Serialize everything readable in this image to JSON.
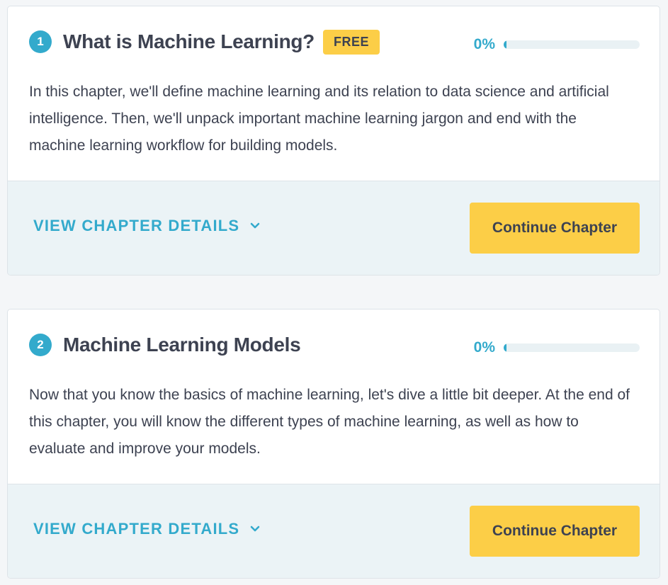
{
  "chapters": [
    {
      "number": "1",
      "title": "What is Machine Learning?",
      "badge": "FREE",
      "progress_text": "0%",
      "progress": 0,
      "description": "In this chapter, we'll define machine learning and its relation to data science and artificial intelligence. Then, we'll unpack important machine learning jargon and end with the machine learning workflow for building models.",
      "details_label": "VIEW CHAPTER DETAILS",
      "button_label": "Continue Chapter"
    },
    {
      "number": "2",
      "title": "Machine Learning Models",
      "progress_text": "0%",
      "progress": 0,
      "description": "Now that you know the basics of machine learning, let's dive a little bit deeper. At the end of this chapter, you will know the different types of machine learning, as well as how to evaluate and improve your models.",
      "details_label": "VIEW CHAPTER DETAILS",
      "button_label": "Continue Chapter"
    }
  ],
  "icons": {
    "details_toggle": "chevron-down-icon"
  },
  "colors": {
    "accent_blue": "#33aacc",
    "accent_yellow": "#fcce47",
    "text_dark": "#3d4251",
    "footer_bg": "#ebf3f6",
    "page_bg": "#f4f6f8"
  }
}
